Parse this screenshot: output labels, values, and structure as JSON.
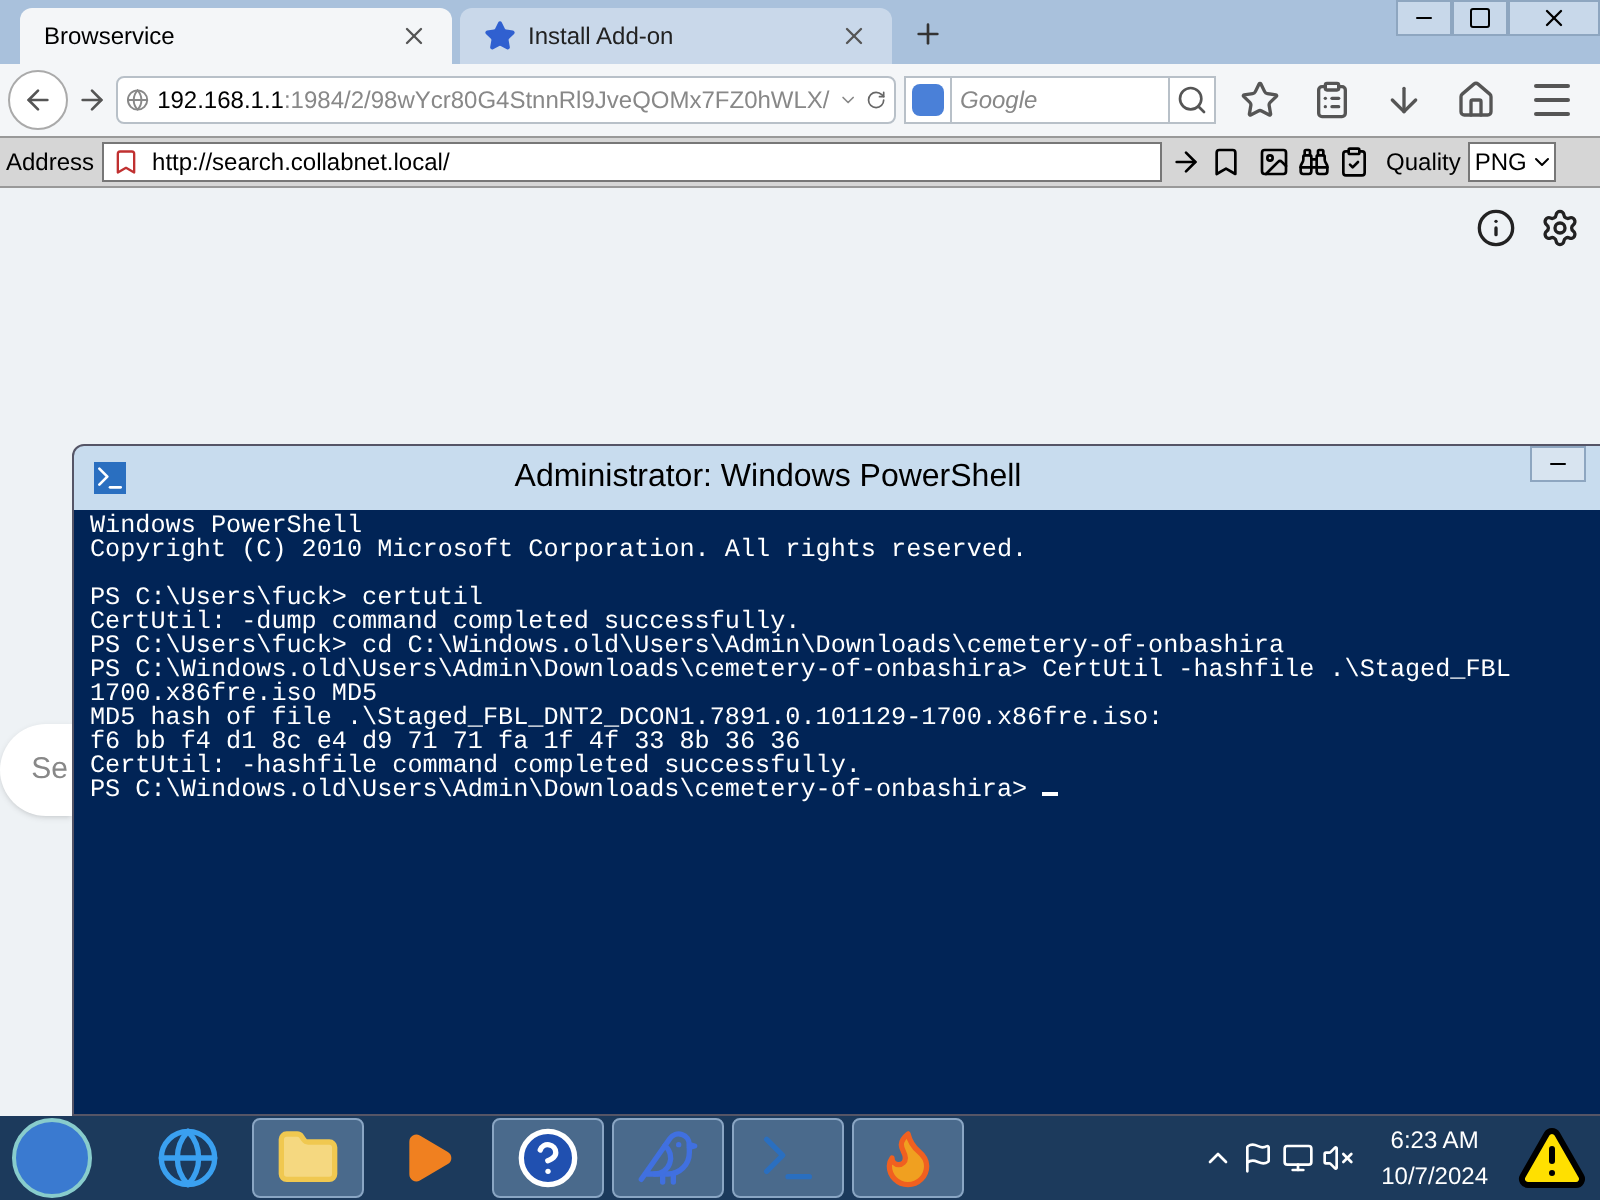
{
  "tabs": [
    {
      "label": "Browservice",
      "selected": true
    },
    {
      "label": "Install Add-on",
      "selected": false
    }
  ],
  "nav": {
    "url_host": "192.168.1.1",
    "url_path": ":1984/2/98wYcr80G4StnnRl9JveQOMx7FZ0hWLX/",
    "search_placeholder": "Google"
  },
  "toolbar": {
    "address_label": "Address",
    "address_value": "http://search.collabnet.local/",
    "quality_label": "Quality",
    "quality_value": "PNG"
  },
  "page": {
    "search_partial": "Se"
  },
  "console": {
    "title": "Administrator: Windows PowerShell",
    "blocks": [
      [
        "Windows PowerShell",
        "Copyright (C) 2010 Microsoft Corporation. All rights reserved."
      ],
      [
        "PS C:\\Users\\fuck> certutil",
        "CertUtil: -dump command completed successfully.",
        "PS C:\\Users\\fuck> cd C:\\Windows.old\\Users\\Admin\\Downloads\\cemetery-of-onbashira",
        "PS C:\\Windows.old\\Users\\Admin\\Downloads\\cemetery-of-onbashira> CertUtil -hashfile .\\Staged_FBL",
        "1700.x86fre.iso MD5",
        "MD5 hash of file .\\Staged_FBL_DNT2_DCON1.7891.0.101129-1700.x86fre.iso:",
        "f6 bb f4 d1 8c e4 d9 71 71 fa 1f 4f 33 8b 36 36",
        "CertUtil: -hashfile command completed successfully.",
        "PS C:\\Windows.old\\Users\\Admin\\Downloads\\cemetery-of-onbashira> "
      ]
    ],
    "cursor": true
  },
  "taskbar": {
    "apps": [
      {
        "kind": "ie",
        "active": false
      },
      {
        "kind": "folder",
        "active": true
      },
      {
        "kind": "media",
        "active": false
      },
      {
        "kind": "help",
        "active": true
      },
      {
        "kind": "bird",
        "active": true
      },
      {
        "kind": "shell",
        "active": true
      },
      {
        "kind": "firefox",
        "active": true
      }
    ],
    "time": "6:23 AM",
    "date": "10/7/2024"
  }
}
